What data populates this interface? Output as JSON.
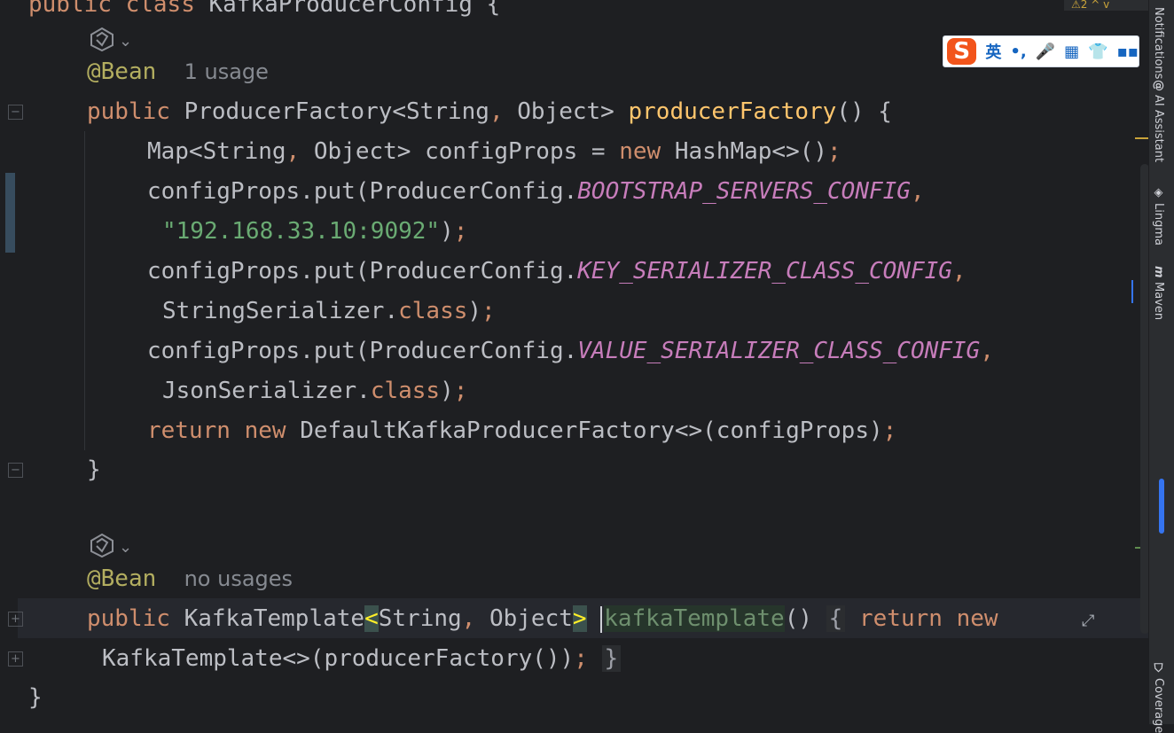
{
  "editor": {
    "class_header": {
      "kw1": "public",
      "kw2": "class",
      "name": "KafkaProducerConfig",
      "brace": "{"
    },
    "bean1": {
      "annotation": "@Bean",
      "usage_hint": "1 usage",
      "sig": {
        "kw": "public",
        "ret_type": "ProducerFactory<String",
        "comma": ",",
        "ret_type2": " Object> ",
        "method": "producerFactory",
        "rest": "() {"
      },
      "line_map": {
        "pre": "Map<String",
        "comma": ",",
        "mid": " Object> configProps = ",
        "kw": "new",
        "post": " HashMap<>()",
        "semi": ";"
      },
      "line_put1a": {
        "pre": "configProps.put(ProducerConfig.",
        "const": "BOOTSTRAP_SERVERS_CONFIG",
        "comma": ","
      },
      "line_put1b": {
        "str": "\"192.168.33.10:9092\"",
        "post": ")",
        "semi": ";"
      },
      "line_put2a": {
        "pre": "configProps.put(ProducerConfig.",
        "const": "KEY_SERIALIZER_CLASS_CONFIG",
        "comma": ","
      },
      "line_put2b": {
        "pre": "StringSerializer.",
        "kw": "class",
        "post": ")",
        "semi": ";"
      },
      "line_put3a": {
        "pre": "configProps.put(ProducerConfig.",
        "const": "VALUE_SERIALIZER_CLASS_CONFIG",
        "comma": ","
      },
      "line_put3b": {
        "pre": "JsonSerializer.",
        "kw": "class",
        "post": ")",
        "semi": ";"
      },
      "line_return": {
        "kw1": "return",
        "kw2": "new",
        "post": " DefaultKafkaProducerFactory<>(configProps)",
        "semi": ";"
      },
      "close": "}"
    },
    "bean2": {
      "annotation": "@Bean",
      "usage_hint": "no usages",
      "sig": {
        "kw": "public",
        "type": "KafkaTemplate",
        "lt": "<",
        "generic": "String",
        "comma": ",",
        "generic2": " Object",
        "gt": ">",
        "method": "kafkaTemplate",
        "parens": "()",
        "brace_open": "{",
        "kw_return": "return",
        "kw_new": "new"
      },
      "cont": {
        "pre": "KafkaTemplate<>(producerFactory())",
        "semi": ";",
        "brace_close": "}"
      }
    },
    "class_close": "}"
  },
  "right_toolbar": [
    {
      "label": "Notifications",
      "icon": "bell-icon"
    },
    {
      "label": "AI Assistant",
      "icon": "at-icon"
    },
    {
      "label": "Lingma",
      "icon": "lingma-icon"
    },
    {
      "label": "Maven",
      "icon": "maven-icon"
    },
    {
      "label": "Coverage",
      "icon": "shield-icon"
    }
  ],
  "top_badge": "⚠2 ^ v",
  "ime_toolbar": {
    "logo": "S",
    "lang": "英",
    "punct": "•,",
    "mic": "🎤",
    "keyboard": "▦",
    "skin": "👕",
    "grid": "▪▪"
  },
  "colors": {
    "background": "#1e1f22",
    "keyword": "#cf8e6d",
    "method_decl": "#ffc66d",
    "constant": "#c77dbb",
    "string": "#6aab73",
    "annotation": "#b3ae60"
  }
}
